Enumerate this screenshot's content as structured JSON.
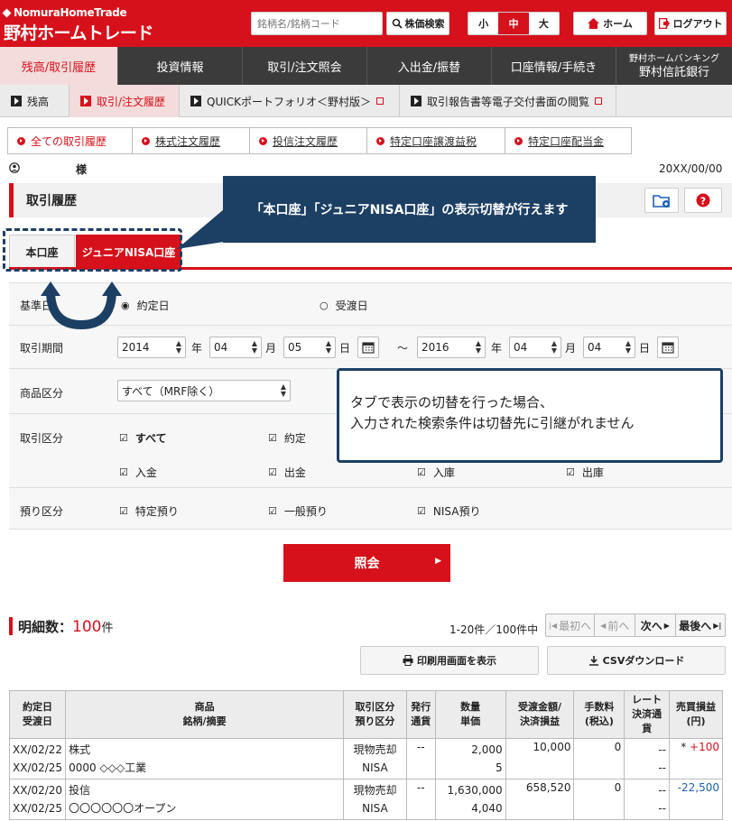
{
  "header": {
    "logo_top": "NomuraHomeTrade",
    "logo_main": "野村ホームトレード",
    "search_placeholder": "銘柄名/銘柄コード",
    "search_button": "株価検索",
    "size_small": "小",
    "size_mid": "中",
    "size_large": "大",
    "home": "ホーム",
    "logout": "ログアウト"
  },
  "nav": [
    {
      "label": "残高/取引履歴"
    },
    {
      "label": "投資情報"
    },
    {
      "label": "取引/注文照会"
    },
    {
      "label": "入出金/振替"
    },
    {
      "label": "口座情報/手続き"
    }
  ],
  "nav_bank": {
    "line1": "野村ホームバンキング",
    "line2": "野村信託銀行"
  },
  "subnav": [
    {
      "label": "残高"
    },
    {
      "label": "取引/注文履歴"
    },
    {
      "label": "QUICKポートフォリオ＜野村版＞"
    },
    {
      "label": "取引報告書等電子交付書面の閲覧"
    }
  ],
  "subtabs": [
    {
      "label": "全ての取引履歴"
    },
    {
      "label": "株式注文履歴"
    },
    {
      "label": "投信注文履歴"
    },
    {
      "label": "特定口座譲渡益税"
    },
    {
      "label": "特定口座配当金"
    }
  ],
  "user": {
    "suffix": "様",
    "date": "20XX/00/00"
  },
  "page_title": "取引履歴",
  "acct_tabs": {
    "main": "本口座",
    "junior": "ジュニアNISA口座"
  },
  "callout": "「本口座」「ジュニアNISA口座」の表示切替が行えます",
  "note": {
    "line1": "タブで表示の切替を行った場合、",
    "line2": "入力された検索条件は切替先に引継がれません"
  },
  "form": {
    "base_label": "基準日",
    "opt_trade": "約定日",
    "opt_settle": "受渡日",
    "period_label": "取引期間",
    "from_year": "2014",
    "from_month": "04",
    "from_day": "05",
    "to_year": "2016",
    "to_month": "04",
    "to_day": "04",
    "nen": "年",
    "tsuki": "月",
    "hi": "日",
    "tilde": "～",
    "product_label": "商品区分",
    "product_value": "すべて（MRF除く）",
    "trade_label": "取引区分",
    "trade_all": "すべて",
    "trade_exec": "約定",
    "trade_in": "入金",
    "trade_out": "出金",
    "trade_incoming": "入庫",
    "trade_outgoing": "出庫",
    "deposit_label": "預り区分",
    "dep_special": "特定預り",
    "dep_general": "一般預り",
    "dep_nisa": "NISA預り"
  },
  "submit": "照会",
  "results": {
    "count_label": "明細数：",
    "count_value": "100",
    "count_unit": "件",
    "range": "1-20件／100件中",
    "first": "最初へ",
    "prev": "前へ",
    "next": "次へ",
    "last": "最後へ",
    "print": "印刷用画面を表示",
    "csv": "CSVダウンロード"
  },
  "table": {
    "headers": [
      "約定日\n受渡日",
      "商品\n銘柄/摘要",
      "取引区分\n預り区分",
      "発行\n通貨",
      "数量\n単価",
      "受渡金額/\n決済損益",
      "手数料\n(税込)",
      "レート\n決済通貨",
      "売買損益\n(円)"
    ],
    "rows": [
      {
        "date1": "XX/02/22",
        "date2": "XX/02/25",
        "prod1": "株式",
        "prod2": "0000 ◇◇◇工業",
        "kind1": "現物売却",
        "kind2": "NISA",
        "cur": "--",
        "qty": "2,000",
        "price": "5",
        "amount": "10,000",
        "fee": "0",
        "rate1": "--",
        "rate2": "--",
        "mark": "*",
        "pl": "+100"
      },
      {
        "date1": "XX/02/20",
        "date2": "XX/02/25",
        "prod1": "投信",
        "prod2": "〇〇〇〇〇〇オープン",
        "kind1": "現物売却",
        "kind2": "NISA",
        "cur": "--",
        "qty": "1,630,000",
        "price": "4,040",
        "amount": "658,520",
        "fee": "0",
        "rate1": "--",
        "rate2": "--",
        "mark": "",
        "pl": "-22,500"
      }
    ]
  },
  "colors": {
    "brand": "#d6111b",
    "navy": "#1c3f64",
    "pl_positive": "#d6111b",
    "pl_negative": "#1a5fb4"
  }
}
